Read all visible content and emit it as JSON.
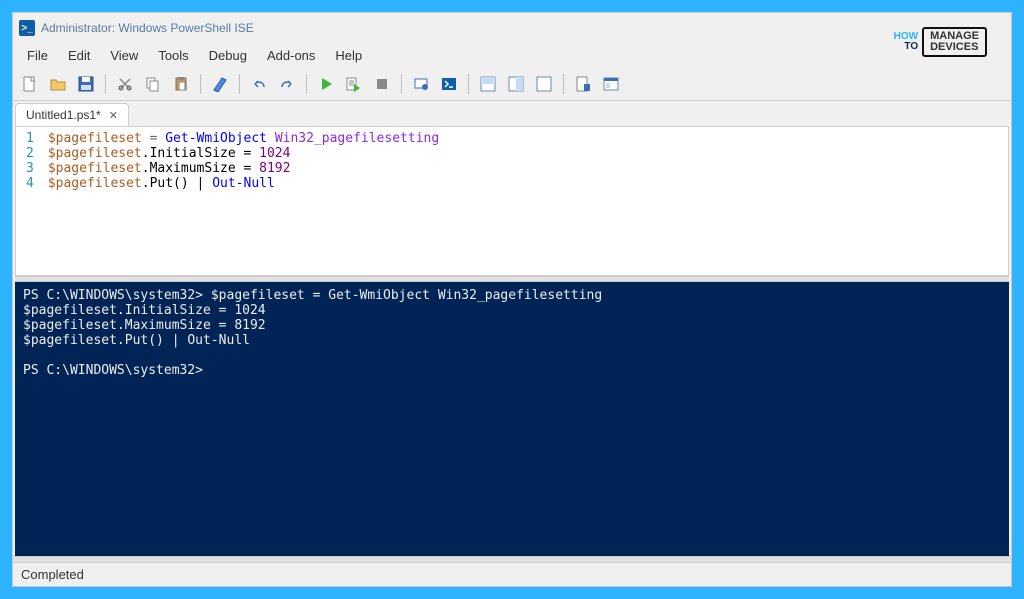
{
  "title": "Administrator: Windows PowerShell ISE",
  "menu": [
    "File",
    "Edit",
    "View",
    "Tools",
    "Debug",
    "Add-ons",
    "Help"
  ],
  "tab": {
    "label": "Untitled1.ps1*"
  },
  "editor": {
    "lines": [
      {
        "num": 1,
        "tokens": [
          {
            "t": "$pagefileset",
            "c": "tok-var"
          },
          {
            "t": " = ",
            "c": "tok-op"
          },
          {
            "t": "Get-WmiObject",
            "c": "tok-cmd"
          },
          {
            "t": " ",
            "c": ""
          },
          {
            "t": "Win32_pagefilesetting",
            "c": "tok-barew"
          }
        ]
      },
      {
        "num": 2,
        "tokens": [
          {
            "t": "$pagefileset",
            "c": "tok-var"
          },
          {
            "t": ".InitialSize = ",
            "c": "tok-member"
          },
          {
            "t": "1024",
            "c": "tok-num"
          }
        ]
      },
      {
        "num": 3,
        "tokens": [
          {
            "t": "$pagefileset",
            "c": "tok-var"
          },
          {
            "t": ".MaximumSize = ",
            "c": "tok-member"
          },
          {
            "t": "8192",
            "c": "tok-num"
          }
        ]
      },
      {
        "num": 4,
        "tokens": [
          {
            "t": "$pagefileset",
            "c": "tok-var"
          },
          {
            "t": ".Put() | ",
            "c": "tok-member"
          },
          {
            "t": "Out-Null",
            "c": "tok-cmd"
          }
        ]
      }
    ]
  },
  "console": "PS C:\\WINDOWS\\system32> $pagefileset = Get-WmiObject Win32_pagefilesetting\n$pagefileset.InitialSize = 1024\n$pagefileset.MaximumSize = 8192\n$pagefileset.Put() | Out-Null\n\nPS C:\\WINDOWS\\system32> ",
  "status": "Completed",
  "watermark": {
    "how": "HOW",
    "to": "TO",
    "manage": "MANAGE",
    "devices": "DEVICES"
  }
}
